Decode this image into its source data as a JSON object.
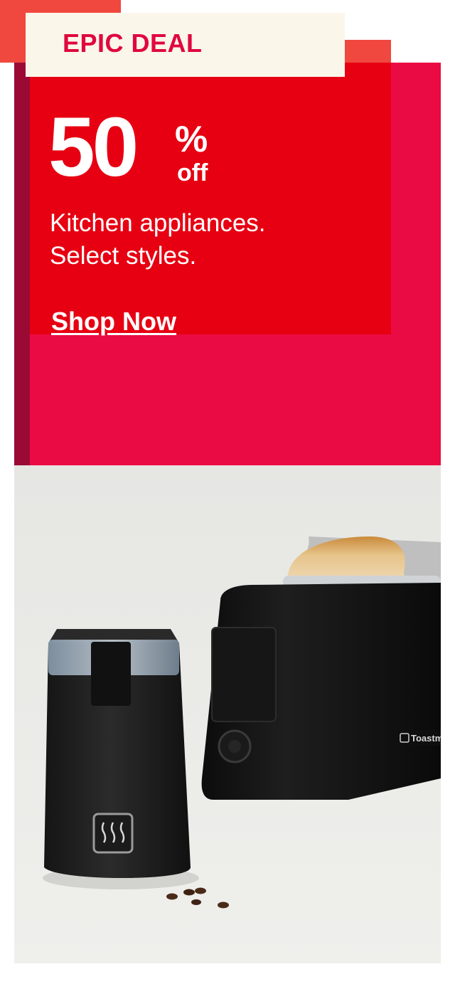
{
  "promo": {
    "tag": "EPIC DEAL",
    "discount_value": "50",
    "percent_symbol": "%",
    "off_text": "off",
    "subtitle_line1": "Kitchen appliances.",
    "subtitle_line2": "Select styles.",
    "cta": "Shop Now"
  },
  "product_image": {
    "brand_label": "Toastma"
  },
  "colors": {
    "tag_text": "#e0083e",
    "tag_bg": "#fbf6ea",
    "promo_red": "#e60012",
    "promo_pink": "#eb0b44",
    "accent_coral": "#f0483f"
  }
}
